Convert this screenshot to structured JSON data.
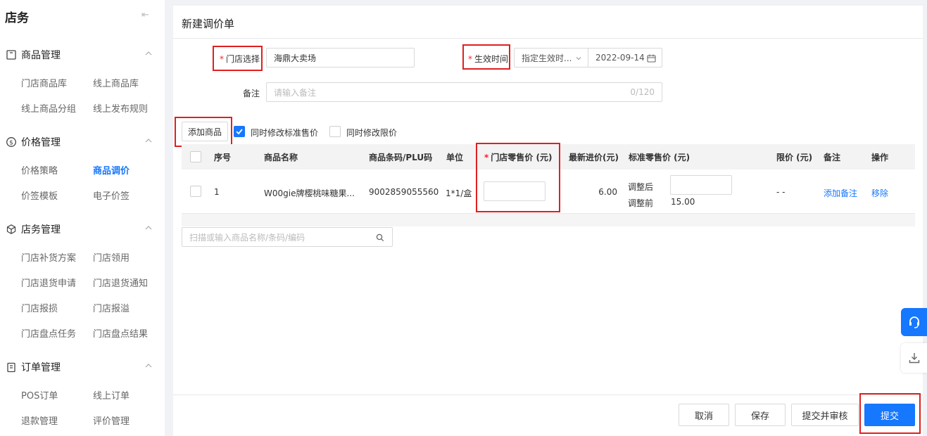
{
  "sidebar": {
    "title": "店务",
    "collapse_icon": "collapse-left-icon",
    "sections": [
      {
        "label": "商品管理",
        "icon": "box-icon",
        "items": [
          "门店商品库",
          "线上商品库",
          "线上商品分组",
          "线上发布规则"
        ]
      },
      {
        "label": "价格管理",
        "icon": "dollar-icon",
        "items": [
          "价格策略",
          "商品调价",
          "价签模板",
          "电子价签"
        ],
        "active_item": "商品调价"
      },
      {
        "label": "店务管理",
        "icon": "cube-icon",
        "items": [
          "门店补货方案",
          "门店领用",
          "门店退货申请",
          "门店退货通知",
          "门店报损",
          "门店报溢",
          "门店盘点任务",
          "门店盘点结果"
        ]
      },
      {
        "label": "订单管理",
        "icon": "clipboard-icon",
        "items": [
          "POS订单",
          "线上订单",
          "退款管理",
          "评价管理"
        ]
      }
    ]
  },
  "form": {
    "page_title": "新建调价单",
    "store_label": "门店选择",
    "store_value": "海鼎大卖场",
    "effective_label": "生效时间",
    "effective_mode": "指定生效时...",
    "effective_date": "2022-09-14",
    "remark_label": "备注",
    "remark_placeholder": "请输入备注",
    "remark_count": "0/120",
    "add_goods_button": "添加商品",
    "sync_standard_price": {
      "label": "同时修改标准售价",
      "checked": true
    },
    "sync_limit_price": {
      "label": "同时修改限价",
      "checked": false
    }
  },
  "table": {
    "columns": [
      "序号",
      "商品名称",
      "商品条码/PLU码",
      "单位",
      "门店零售价 (元)",
      "最新进价(元)",
      "标准零售价 (元)",
      "限价 (元)",
      "备注",
      "操作"
    ],
    "rows": [
      {
        "index": "1",
        "name": "W00gie牌樱桃味糖果...",
        "barcode": "9002859055560",
        "unit": "1*1/盒",
        "store_price": "",
        "latest_cost": "6.00",
        "adjusted_after_label": "调整后",
        "adjusted_before_label": "调整前",
        "standard_before": "15.00",
        "limit_price": "- -",
        "remark_action": "添加备注",
        "remove_action": "移除"
      }
    ]
  },
  "search": {
    "placeholder": "扫描或输入商品名称/条码/编码"
  },
  "footer": {
    "cancel": "取消",
    "save": "保存",
    "submit_review": "提交并审核",
    "submit": "提交"
  },
  "colors": {
    "primary": "#1677ff",
    "highlight_box": "#e02020",
    "required": "#f5222d"
  }
}
